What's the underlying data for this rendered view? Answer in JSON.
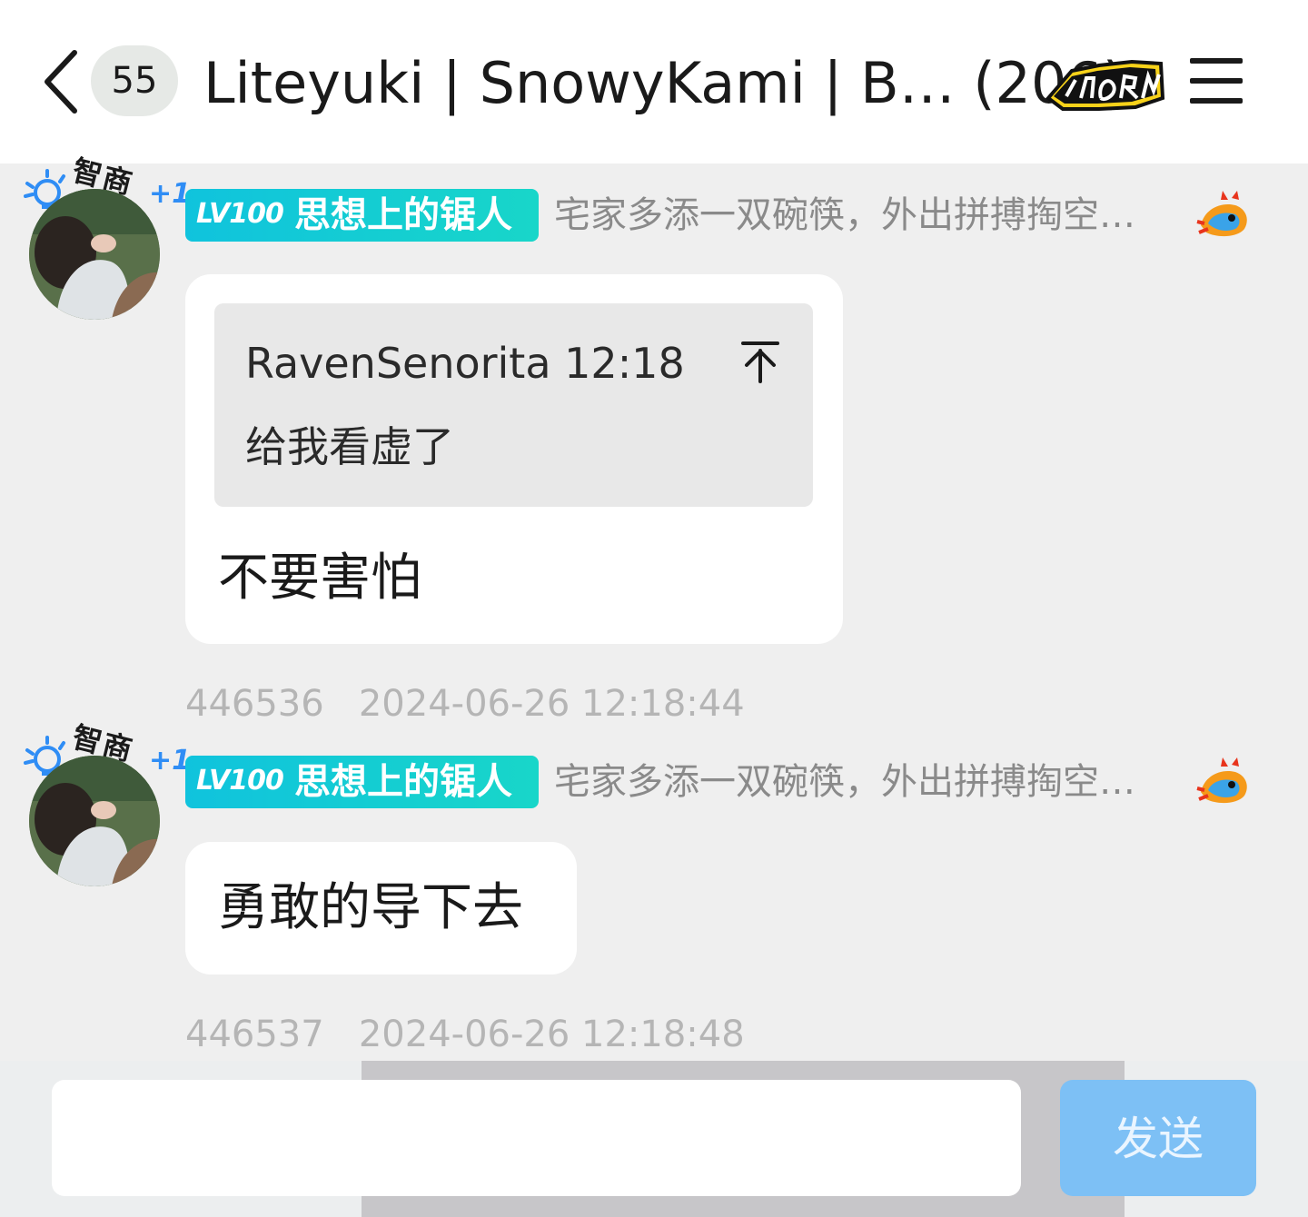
{
  "header": {
    "unread_count": "55",
    "title": "Liteyuki | SnowyKami | B… (206)",
    "back_icon": "chevron-left-icon",
    "menu_icon": "hamburger-menu-icon"
  },
  "messages": [
    {
      "avatar_frame_text": "智商",
      "avatar_frame_plus": "+1",
      "level": "LV100",
      "title": "思想上的锯人",
      "signature": "宅家多添一双碗筷，外出拼搏掏空…",
      "quote": {
        "sender": "RavenSenorita 12:18",
        "text": "给我看虚了"
      },
      "text": "不要害怕",
      "id": "446536",
      "time": "2024-06-26 12:18:44"
    },
    {
      "avatar_frame_text": "智商",
      "avatar_frame_plus": "+1",
      "level": "LV100",
      "title": "思想上的锯人",
      "signature": "宅家多添一双碗筷，外出拼搏掏空…",
      "text": "勇敢的导下去",
      "id": "446537",
      "time": "2024-06-26 12:18:48"
    }
  ],
  "composer": {
    "placeholder": "",
    "send_label": "发送"
  },
  "colors": {
    "level_tag": "#10c3dd",
    "send_button": "#7dc0f5",
    "background": "#efefef"
  }
}
